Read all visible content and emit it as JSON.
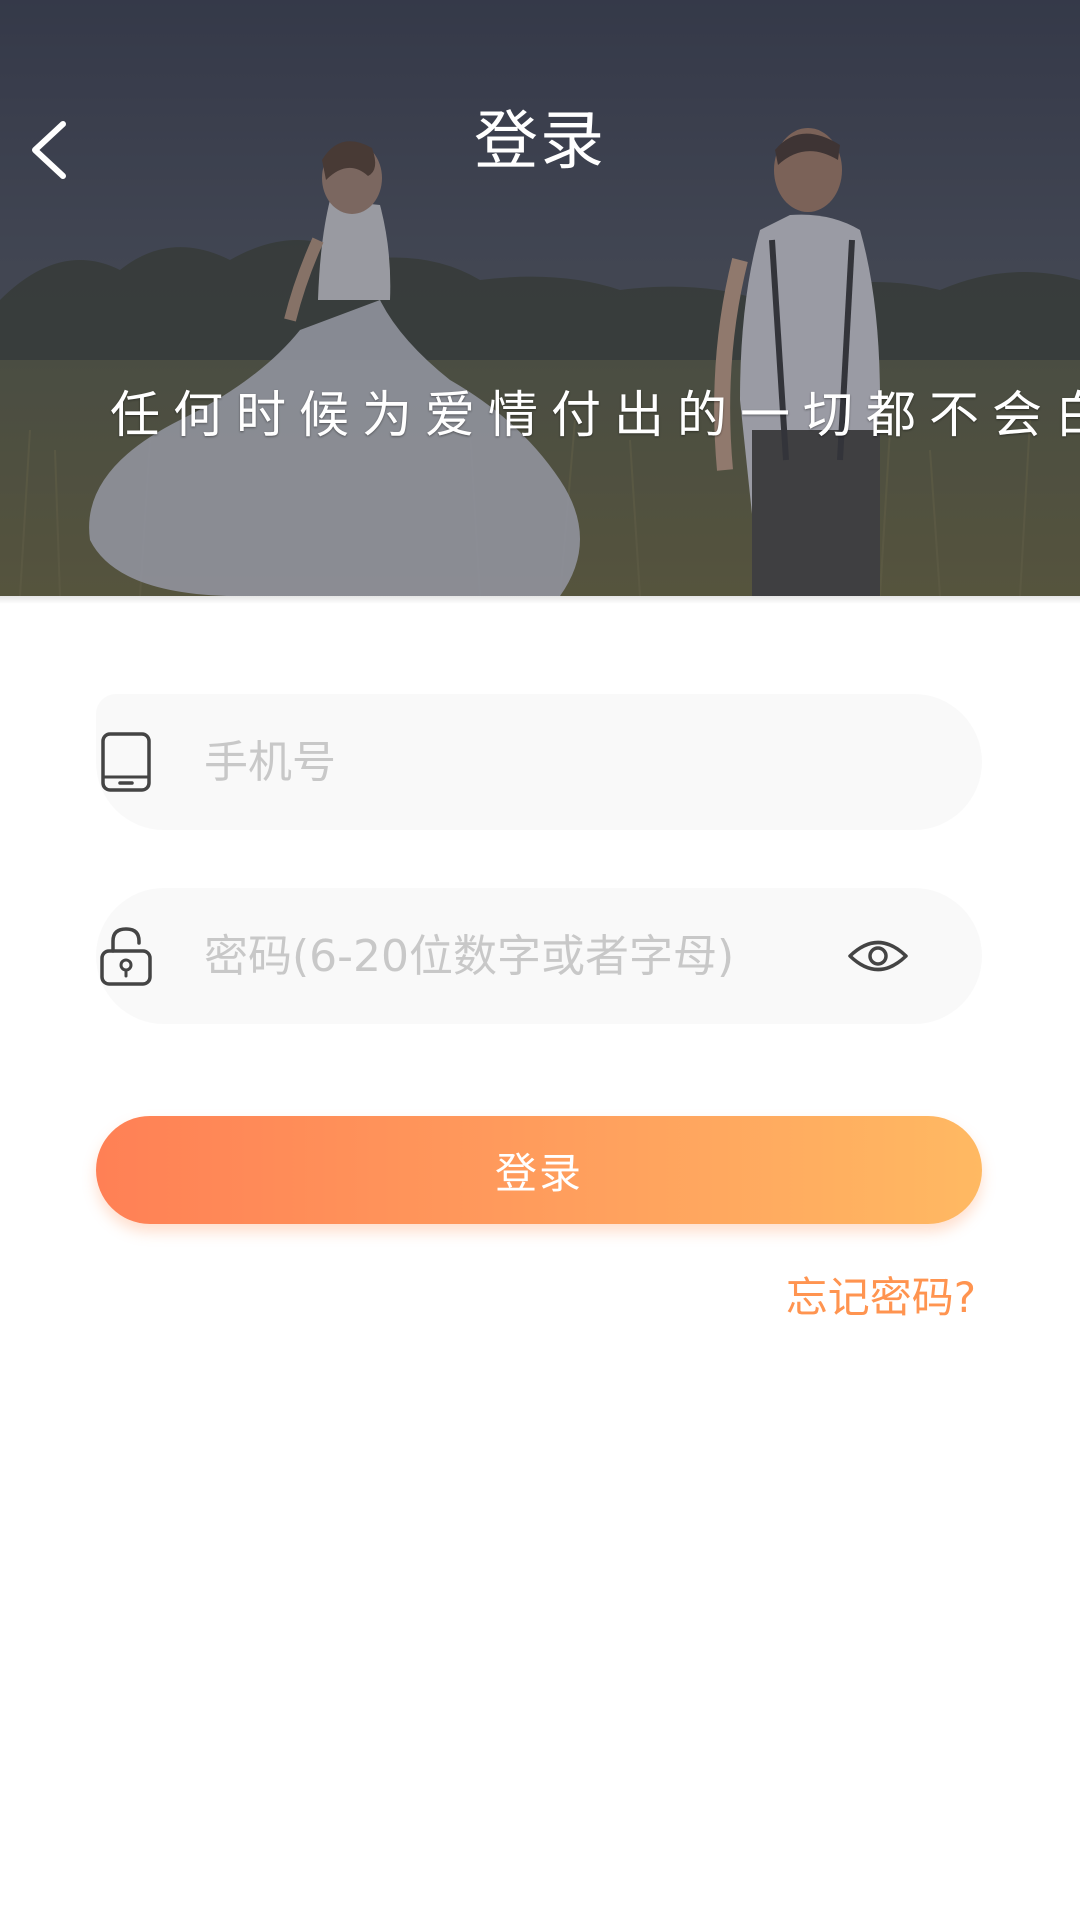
{
  "header": {
    "title": "登录",
    "slogan": "任何时候为爱情付出的一切都不会白白浪费",
    "background_image": "wedding-couple-photo"
  },
  "form": {
    "phone": {
      "placeholder": "手机号",
      "value": "",
      "icon": "phone-icon"
    },
    "password": {
      "placeholder": "密码(6-20位数字或者字母)",
      "value": "",
      "icon": "lock-icon",
      "toggle_icon": "eye-icon"
    },
    "login_label": "登录",
    "forgot_label": "忘记密码?"
  },
  "colors": {
    "accent_start": "#ff8055",
    "accent_end": "#ffb962",
    "link": "#ff9450",
    "field_bg": "#f9f9f9",
    "placeholder": "#c8c8c8"
  }
}
